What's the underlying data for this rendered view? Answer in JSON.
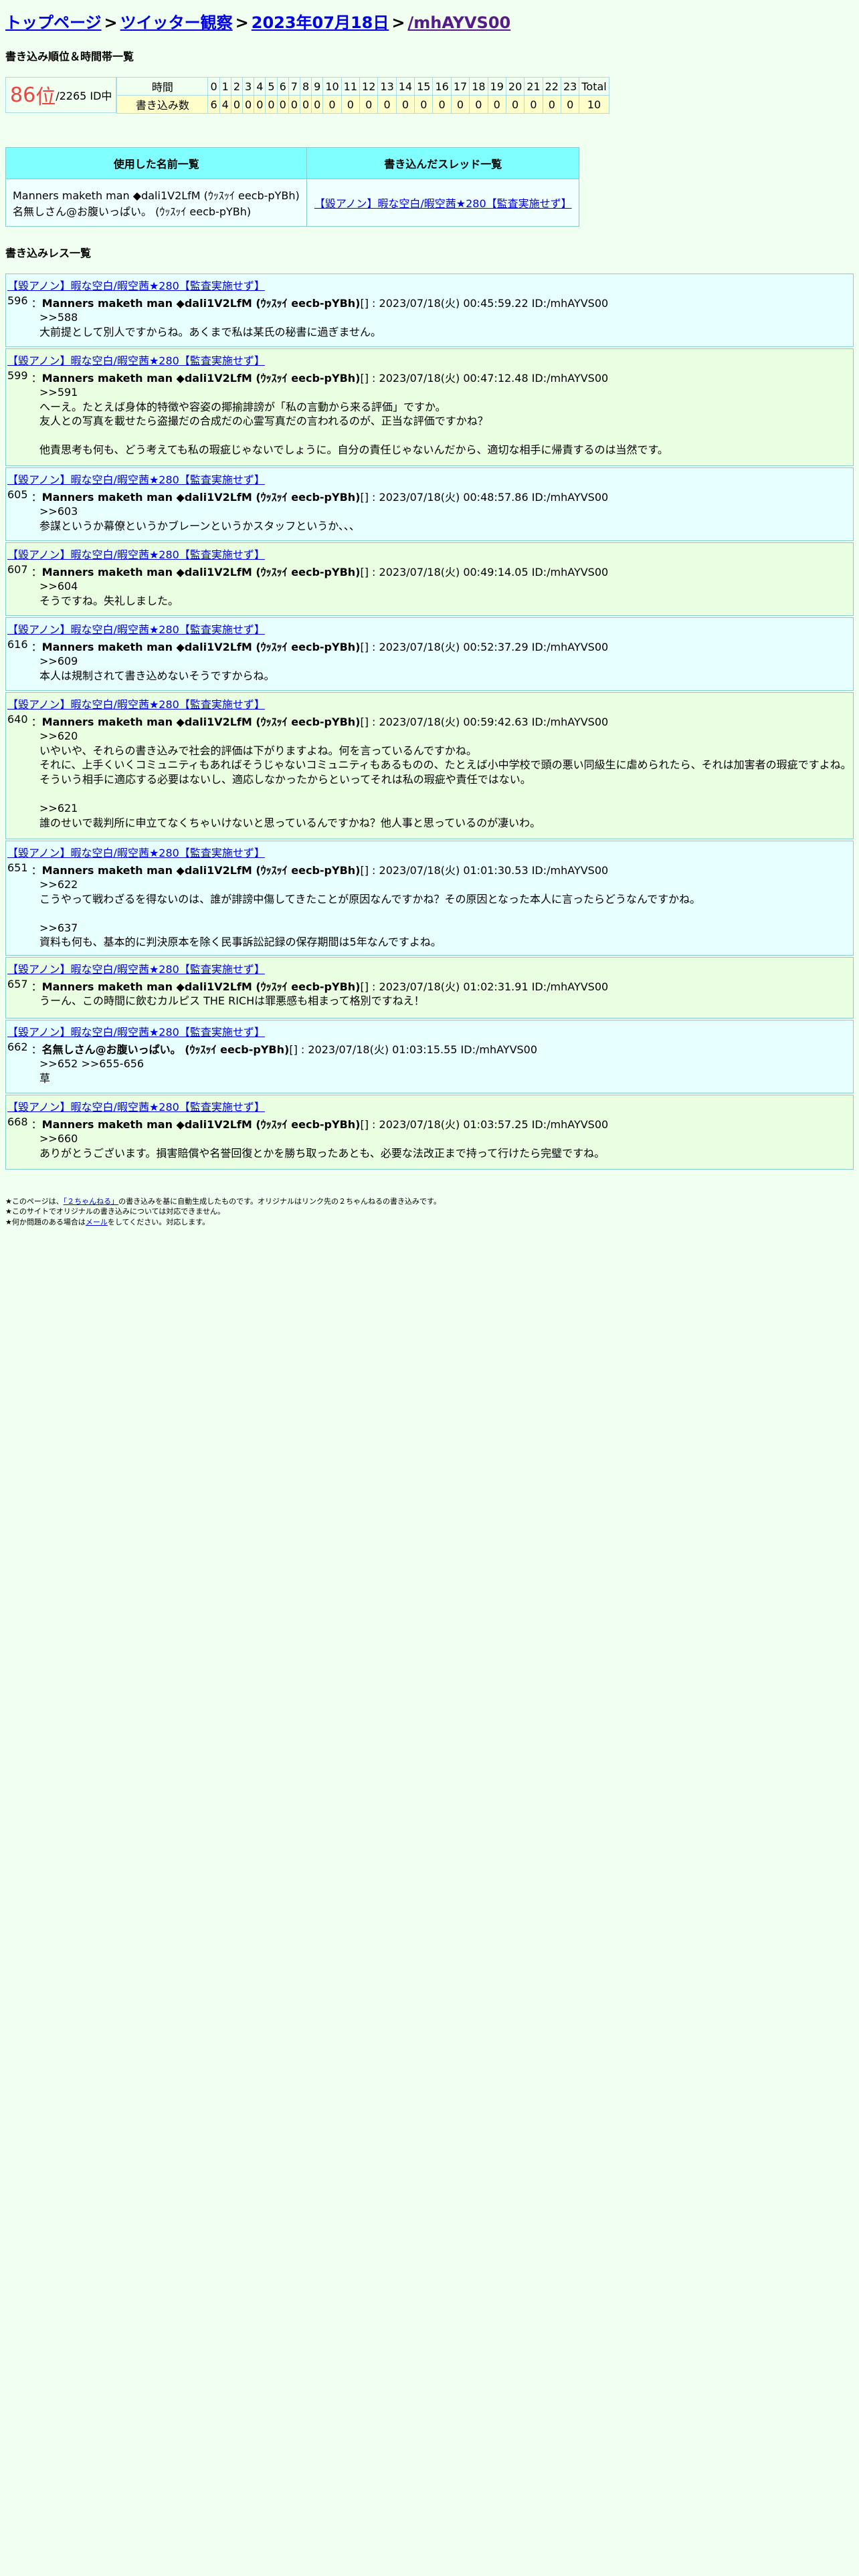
{
  "breadcrumb": {
    "top": "トップページ",
    "category": "ツイッター観察",
    "date": "2023年07月18日",
    "id": "/mhAYVS00",
    "sep": ">"
  },
  "ranking": {
    "section_title": "書き込み順位＆時間帯一覧",
    "rank_num": "86",
    "rank_unit": "位",
    "rank_total": "/2265 ID中",
    "hour_label": "時間",
    "count_label": "書き込み数",
    "hours": [
      "0",
      "1",
      "2",
      "3",
      "4",
      "5",
      "6",
      "7",
      "8",
      "9",
      "10",
      "11",
      "12",
      "13",
      "14",
      "15",
      "16",
      "17",
      "18",
      "19",
      "20",
      "21",
      "22",
      "23",
      "Total"
    ],
    "counts": [
      "6",
      "4",
      "0",
      "0",
      "0",
      "0",
      "0",
      "0",
      "0",
      "0",
      "0",
      "0",
      "0",
      "0",
      "0",
      "0",
      "0",
      "0",
      "0",
      "0",
      "0",
      "0",
      "0",
      "0",
      "10"
    ]
  },
  "names_table": {
    "col_names": "使用した名前一覧",
    "col_threads": "書き込んだスレッド一覧",
    "names": [
      "Manners maketh man ◆dali1V2LfM (ｳｯｽｯｲ eecb-pYBh)",
      "名無しさん@お腹いっぱい。 (ｳｯｽｯｲ eecb-pYBh)"
    ],
    "thread": "【毀アノン】暇な空白/暇空茜★280【監査実施せず】"
  },
  "posts_section_title": "書き込みレス一覧",
  "posts": [
    {
      "title": "【毀アノン】暇な空白/暇空茜★280【監査実施せず】",
      "num": "596",
      "name": "Manners maketh man ◆dali1V2LfM (ｳｯｽｯｲ eecb-pYBh)",
      "meta": "[] : 2023/07/18(火) 00:45:59.22 ID:/mhAYVS00",
      "body": ">>588\n大前提として別人ですからね。あくまで私は某氏の秘書に過ぎません。"
    },
    {
      "title": "【毀アノン】暇な空白/暇空茜★280【監査実施せず】",
      "num": "599",
      "name": "Manners maketh man ◆dali1V2LfM (ｳｯｽｯｲ eecb-pYBh)",
      "meta": "[] : 2023/07/18(火) 00:47:12.48 ID:/mhAYVS00",
      "body": ">>591\nへーえ。たとえば身体的特徴や容姿の揶揄誹謗が「私の言動から来る評価」ですか。\n友人との写真を載せたら盗撮だの合成だの心霊写真だの言われるのが、正当な評価ですかね？\n\n他責思考も何も、どう考えても私の瑕疵じゃないでしょうに。自分の責任じゃないんだから、適切な相手に帰責するのは当然です。"
    },
    {
      "title": "【毀アノン】暇な空白/暇空茜★280【監査実施せず】",
      "num": "605",
      "name": "Manners maketh man ◆dali1V2LfM (ｳｯｽｯｲ eecb-pYBh)",
      "meta": "[] : 2023/07/18(火) 00:48:57.86 ID:/mhAYVS00",
      "body": ">>603\n参謀というか幕僚というかブレーンというかスタッフというか、、、"
    },
    {
      "title": "【毀アノン】暇な空白/暇空茜★280【監査実施せず】",
      "num": "607",
      "name": "Manners maketh man ◆dali1V2LfM (ｳｯｽｯｲ eecb-pYBh)",
      "meta": "[] : 2023/07/18(火) 00:49:14.05 ID:/mhAYVS00",
      "body": ">>604\nそうですね。失礼しました。"
    },
    {
      "title": "【毀アノン】暇な空白/暇空茜★280【監査実施せず】",
      "num": "616",
      "name": "Manners maketh man ◆dali1V2LfM (ｳｯｽｯｲ eecb-pYBh)",
      "meta": "[] : 2023/07/18(火) 00:52:37.29 ID:/mhAYVS00",
      "body": ">>609\n本人は規制されて書き込めないそうですからね。"
    },
    {
      "title": "【毀アノン】暇な空白/暇空茜★280【監査実施せず】",
      "num": "640",
      "name": "Manners maketh man ◆dali1V2LfM (ｳｯｽｯｲ eecb-pYBh)",
      "meta": "[] : 2023/07/18(火) 00:59:42.63 ID:/mhAYVS00",
      "body": ">>620\nいやいや、それらの書き込みで社会的評価は下がりますよね。何を言っているんですかね。\nそれに、上手くいくコミュニティもあればそうじゃないコミュニティもあるものの、たとえば小中学校で頭の悪い同級生に虐められたら、それは加害者の瑕疵ですよね。\nそういう相手に適応する必要はないし、適応しなかったからといってそれは私の瑕疵や責任ではない。\n\n>>621\n誰のせいで裁判所に申立てなくちゃいけないと思っているんですかね？他人事と思っているのが凄いわ。"
    },
    {
      "title": "【毀アノン】暇な空白/暇空茜★280【監査実施せず】",
      "num": "651",
      "name": "Manners maketh man ◆dali1V2LfM (ｳｯｽｯｲ eecb-pYBh)",
      "meta": "[] : 2023/07/18(火) 01:01:30.53 ID:/mhAYVS00",
      "body": ">>622\nこうやって戦わざるを得ないのは、誰が誹謗中傷してきたことが原因なんですかね？その原因となった本人に言ったらどうなんですかね。\n\n>>637\n資料も何も、基本的に判決原本を除く民事訴訟記録の保存期間は5年なんですよね。"
    },
    {
      "title": "【毀アノン】暇な空白/暇空茜★280【監査実施せず】",
      "num": "657",
      "name": "Manners maketh man ◆dali1V2LfM (ｳｯｽｯｲ eecb-pYBh)",
      "meta": "[] : 2023/07/18(火) 01:02:31.91 ID:/mhAYVS00",
      "body": "うーん、この時間に飲むカルピス THE RICHは罪悪感も相まって格別ですねえ！"
    },
    {
      "title": "【毀アノン】暇な空白/暇空茜★280【監査実施せず】",
      "num": "662",
      "name": "名無しさん@お腹いっぱい。 (ｳｯｽｯｲ eecb-pYBh)",
      "meta": "[] : 2023/07/18(火) 01:03:15.55 ID:/mhAYVS00",
      "body": ">>652 >>655-656\n草"
    },
    {
      "title": "【毀アノン】暇な空白/暇空茜★280【監査実施せず】",
      "num": "668",
      "name": "Manners maketh man ◆dali1V2LfM (ｳｯｽｯｲ eecb-pYBh)",
      "meta": "[] : 2023/07/18(火) 01:03:57.25 ID:/mhAYVS00",
      "body": ">>660\nありがとうございます。損害賠償や名誉回復とかを勝ち取ったあとも、必要な法改正まで持って行けたら完璧ですね。"
    }
  ],
  "footer": {
    "line1_pre": "★このページは、",
    "line1_link": "「２ちゃんねる」",
    "line1_post": "の書き込みを基に自動生成したものです。オリジナルはリンク先の２ちゃんねるの書き込みです。",
    "line2": "★このサイトでオリジナルの書き込みについては対応できません。",
    "line3_pre": "★何か問題のある場合は",
    "line3_link": "メール",
    "line3_post": "をしてください。対応します。"
  }
}
